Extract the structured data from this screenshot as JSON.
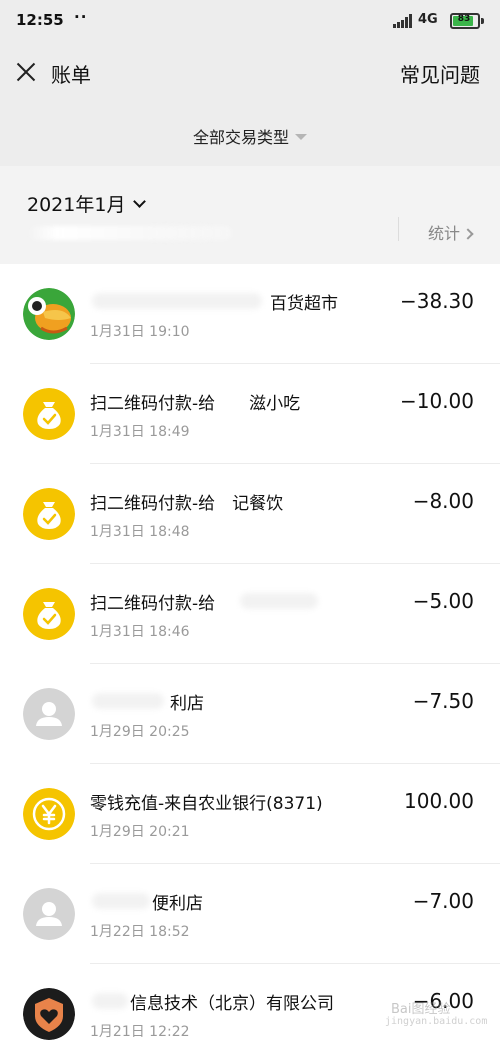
{
  "status_bar": {
    "time": "12:55",
    "dots": "··",
    "network": "4G",
    "battery": "83"
  },
  "nav": {
    "title": "账单",
    "faq": "常见问题"
  },
  "filter": {
    "label": "全部交易类型"
  },
  "summary": {
    "month": "2021年1月",
    "stats_label": "统计"
  },
  "transactions": [
    {
      "icon": "merchant-bird-avatar",
      "title": "百货超市",
      "time": "1月31日 19:10",
      "amount": "−38.30"
    },
    {
      "icon": "money-bag-icon",
      "title": "扫二维码付款-给　　滋小吃",
      "time": "1月31日 18:49",
      "amount": "−10.00"
    },
    {
      "icon": "money-bag-icon",
      "title": "扫二维码付款-给　记餐饮",
      "time": "1月31日 18:48",
      "amount": "−8.00"
    },
    {
      "icon": "money-bag-icon",
      "title": "扫二维码付款-给",
      "time": "1月31日 18:46",
      "amount": "−5.00"
    },
    {
      "icon": "default-user-avatar",
      "title": "利店",
      "time": "1月29日 20:25",
      "amount": "−7.50"
    },
    {
      "icon": "yuan-coin-icon",
      "title": "零钱充值-来自农业银行(8371)",
      "time": "1月29日 20:21",
      "amount": "100.00"
    },
    {
      "icon": "default-user-avatar",
      "title": "便利店",
      "time": "1月22日 18:52",
      "amount": "−7.00"
    },
    {
      "icon": "heart-shield-avatar",
      "title": "信息技术（北京）有限公司",
      "time": "1月21日 12:22",
      "amount": "−6.00"
    }
  ],
  "watermark": {
    "text": "Bai图经验",
    "url": "jingyan.baidu.com"
  },
  "colors": {
    "background": "#ededed",
    "list_background": "#ffffff",
    "money_icon_yellow": "#f5c400",
    "secondary_text": "#9a9a9a"
  }
}
